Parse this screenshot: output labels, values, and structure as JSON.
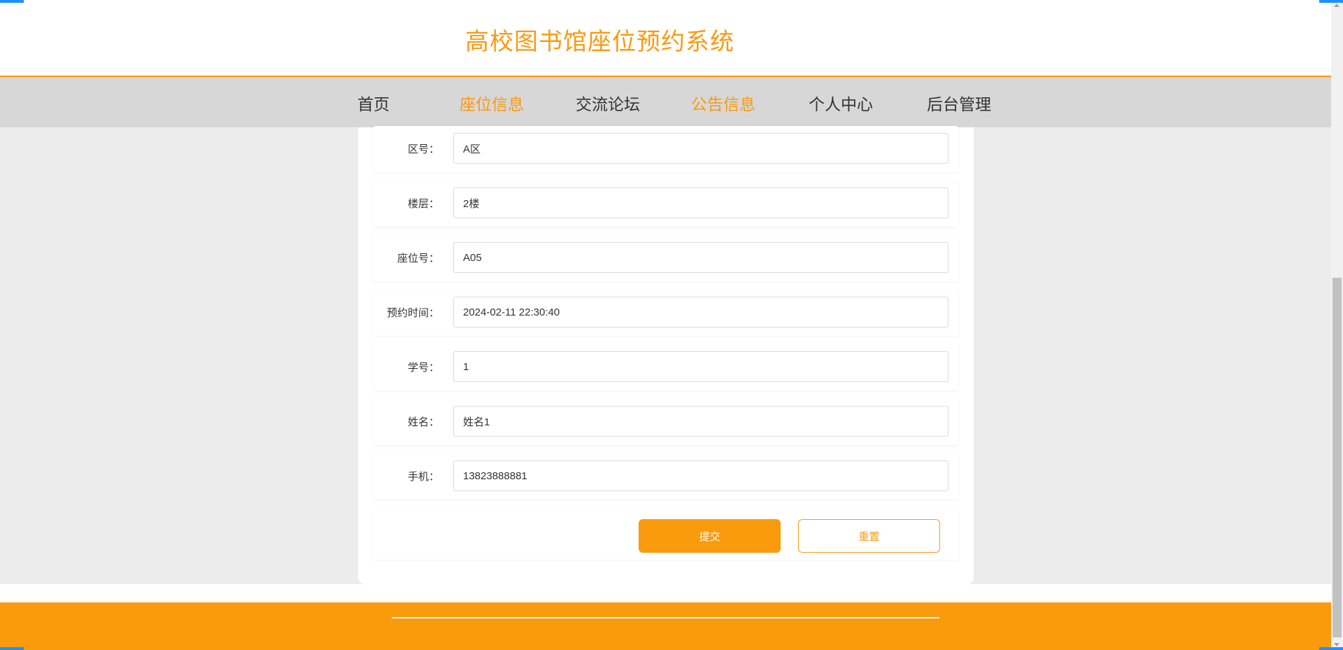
{
  "header": {
    "site_title": "高校图书馆座位预约系统"
  },
  "nav": {
    "items": [
      {
        "label": "首页",
        "active": false
      },
      {
        "label": "座位信息",
        "active": true
      },
      {
        "label": "交流论坛",
        "active": false
      },
      {
        "label": "公告信息",
        "active": true
      },
      {
        "label": "个人中心",
        "active": false
      },
      {
        "label": "后台管理",
        "active": false
      }
    ]
  },
  "form": {
    "fields": [
      {
        "label": "区号：",
        "value": "A区"
      },
      {
        "label": "楼层：",
        "value": "2楼"
      },
      {
        "label": "座位号：",
        "value": "A05"
      },
      {
        "label": "预约时间：",
        "value": "2024-02-11 22:30:40"
      },
      {
        "label": "学号：",
        "value": "1"
      },
      {
        "label": "姓名：",
        "value": "姓名1"
      },
      {
        "label": "手机：",
        "value": "13823888881"
      }
    ],
    "submit_label": "提交",
    "reset_label": "重置"
  },
  "colors": {
    "accent": "#f99a12",
    "nav_bg": "#d7d7d7",
    "page_bg": "#ececec"
  }
}
